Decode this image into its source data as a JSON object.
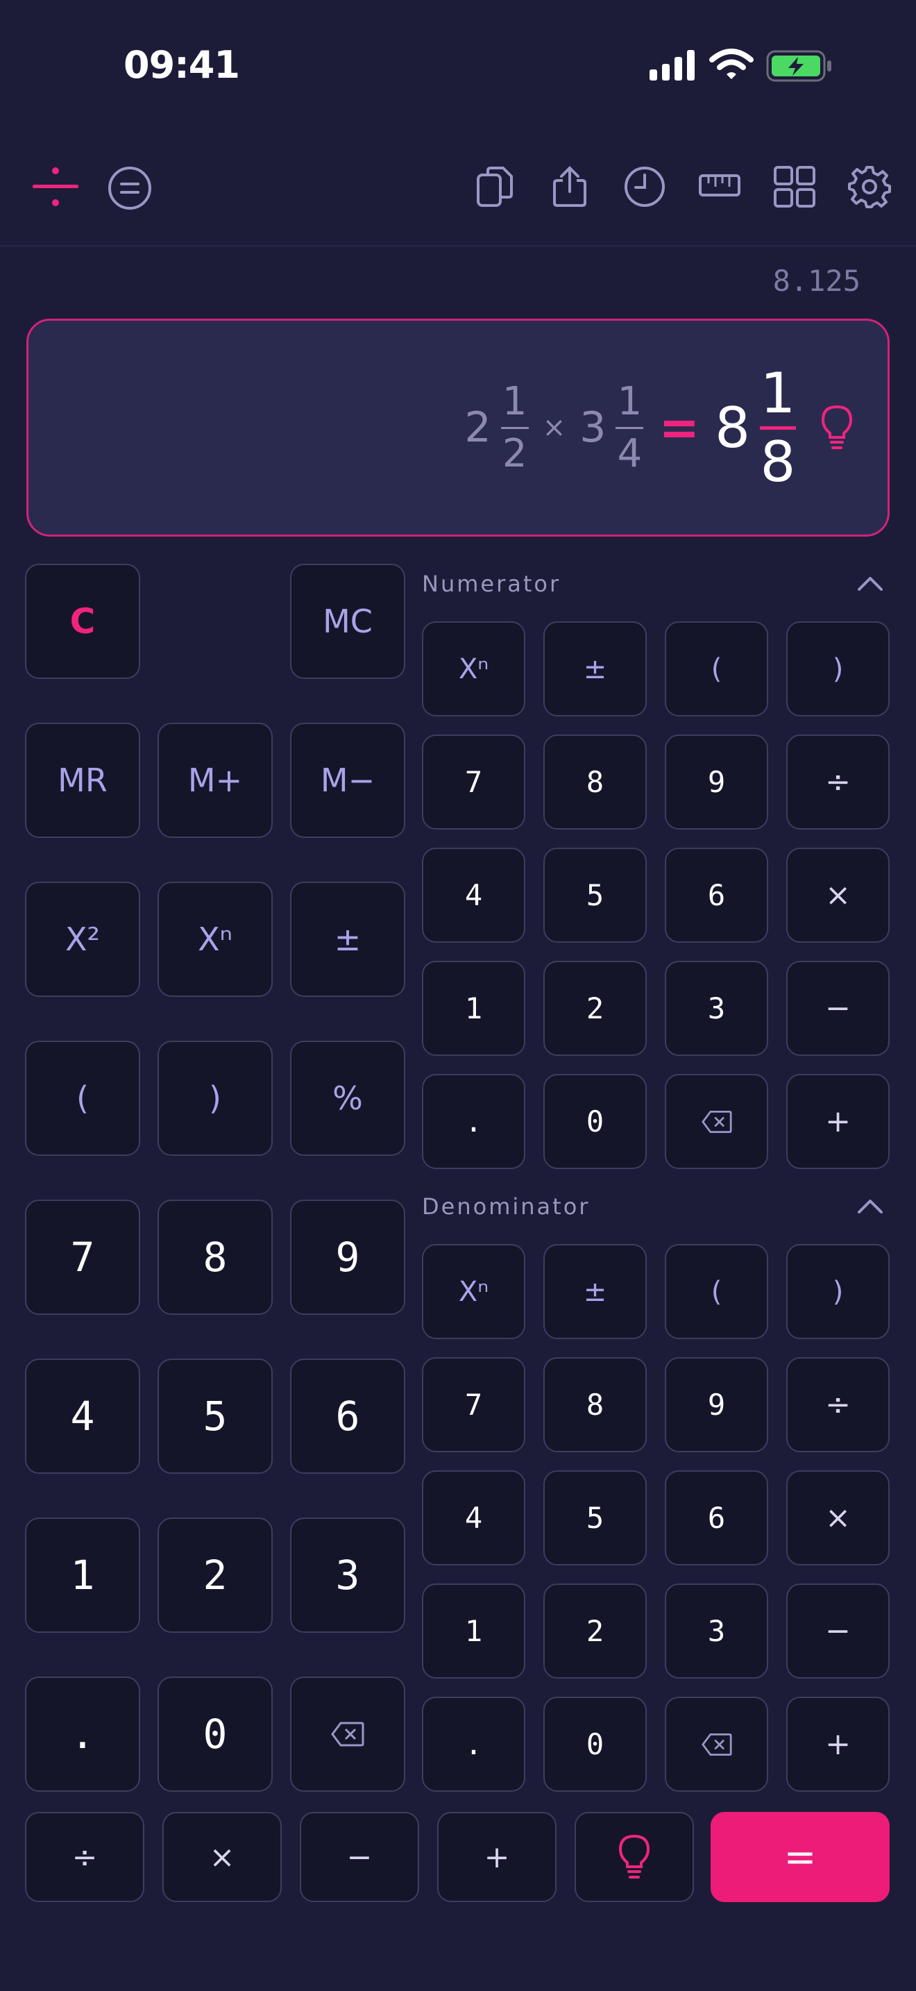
{
  "status": {
    "time": "09:41"
  },
  "toolbar": {
    "left_icons": [
      "divide-icon",
      "equals-circle-icon"
    ],
    "right_icons": [
      "copy-icon",
      "share-icon",
      "history-icon",
      "ruler-icon",
      "grid-icon",
      "gear-icon"
    ],
    "accent": "#f0247e"
  },
  "decimal_result": "8.125",
  "display": {
    "a_whole": "2",
    "a_num": "1",
    "a_den": "2",
    "operator": "×",
    "b_whole": "3",
    "b_num": "1",
    "b_den": "4",
    "equals": "=",
    "r_whole": "8",
    "r_num": "1",
    "r_den": "8"
  },
  "left_keys": {
    "clear": "C",
    "mc": "MC",
    "mr": "MR",
    "mplus": "M+",
    "mminus": "M−",
    "square": "X²",
    "power": "Xⁿ",
    "plusminus": "±",
    "lparen": "(",
    "rparen": ")",
    "percent": "%",
    "seven": "7",
    "eight": "8",
    "nine": "9",
    "four": "4",
    "five": "5",
    "six": "6",
    "one": "1",
    "two": "2",
    "three": "3",
    "dot": ".",
    "zero": "0"
  },
  "numerator": {
    "label": "Numerator",
    "keys": [
      "Xⁿ",
      "±",
      "(",
      ")",
      "7",
      "8",
      "9",
      "÷",
      "4",
      "5",
      "6",
      "×",
      "1",
      "2",
      "3",
      "−",
      ".",
      "0",
      "",
      "+"
    ]
  },
  "denominator": {
    "label": "Denominator",
    "keys": [
      "Xⁿ",
      "±",
      "(",
      ")",
      "7",
      "8",
      "9",
      "÷",
      "4",
      "5",
      "6",
      "×",
      "1",
      "2",
      "3",
      "−",
      ".",
      "0",
      "",
      "+"
    ]
  },
  "bottom_row": {
    "divide": "÷",
    "multiply": "×",
    "minus": "−",
    "plus": "+",
    "equals": "="
  }
}
